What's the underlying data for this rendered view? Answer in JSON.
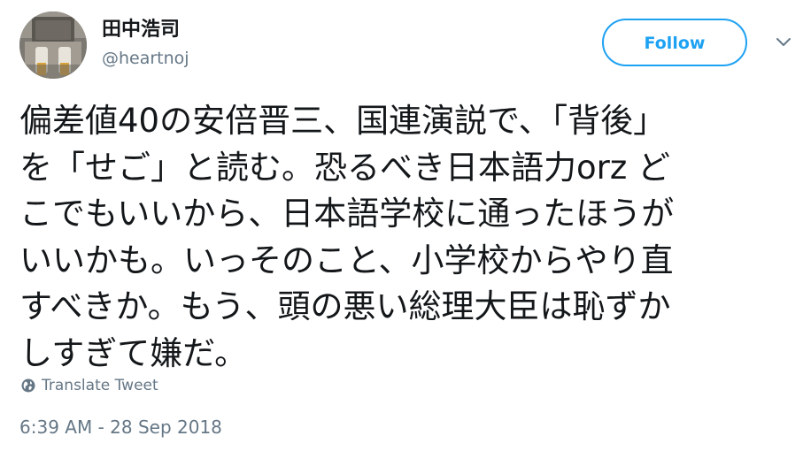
{
  "colors": {
    "accent": "#1da1f2",
    "text_primary": "#14171a",
    "text_secondary": "#657786",
    "background": "#ffffff"
  },
  "user": {
    "display_name": "田中浩司",
    "handle": "@heartnoj",
    "avatar_icon": "profile-photo"
  },
  "actions": {
    "follow_label": "Follow",
    "menu_icon": "chevron-down-icon"
  },
  "tweet": {
    "lines": [
      "偏差値40の安倍晋三、国連演説で、「背後」",
      "を「せご」と読む。恐るべき日本語力orz ど",
      "こでもいいから、日本語学校に通ったほうが",
      "いいかも。いっそのこと、小学校からやり直",
      "すべきか。もう、頭の悪い総理大臣は恥ずか",
      "しすぎて嫌だ。"
    ],
    "translate_label": "Translate Tweet",
    "translate_icon": "globe-icon",
    "timestamp": "6:39 AM - 28 Sep 2018"
  }
}
